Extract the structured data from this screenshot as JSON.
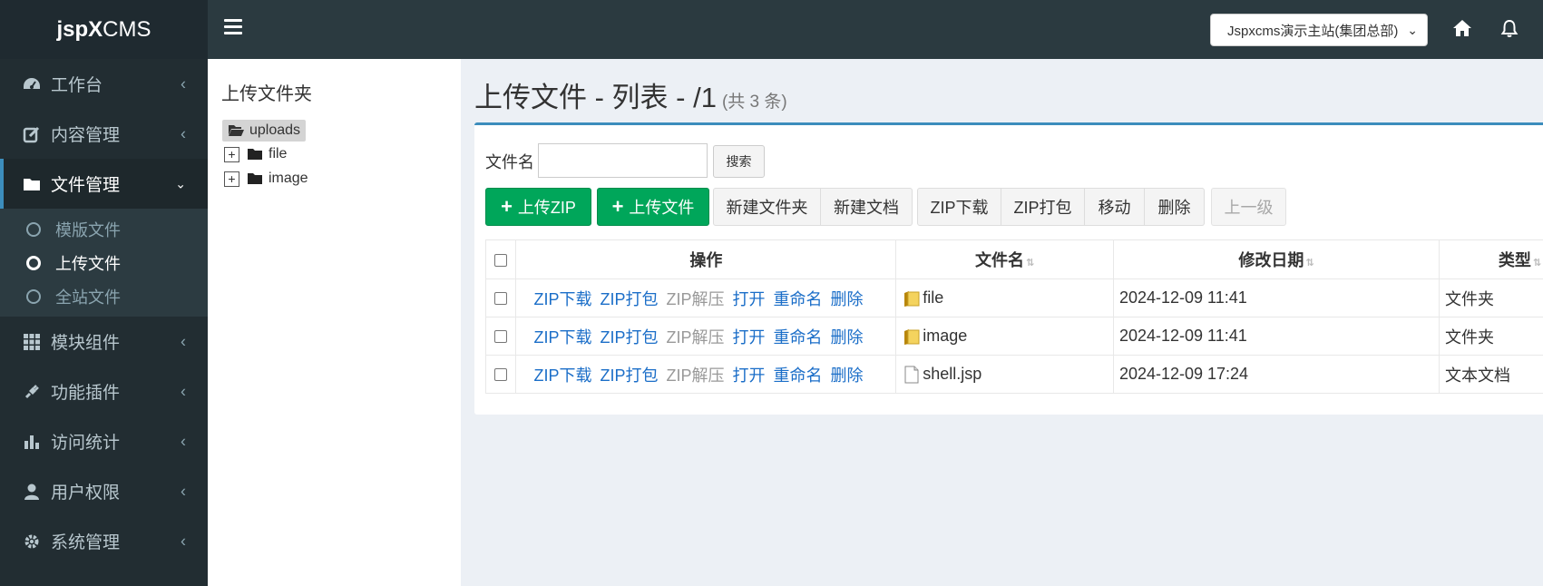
{
  "brand": {
    "bold": "jspX",
    "rest": "CMS"
  },
  "sidebar": {
    "items": [
      {
        "label": "工作台"
      },
      {
        "label": "内容管理"
      },
      {
        "label": "文件管理"
      },
      {
        "label": "模块组件"
      },
      {
        "label": "功能插件"
      },
      {
        "label": "访问统计"
      },
      {
        "label": "用户权限"
      },
      {
        "label": "系统管理"
      }
    ],
    "submenu": [
      {
        "label": "模版文件"
      },
      {
        "label": "上传文件"
      },
      {
        "label": "全站文件"
      }
    ]
  },
  "topbar": {
    "site_select": "Jspxcms演示主站(集团总部)"
  },
  "tree": {
    "title": "上传文件夹",
    "root": "uploads",
    "nodes": [
      {
        "label": "file"
      },
      {
        "label": "image"
      }
    ]
  },
  "page": {
    "title": "上传文件 - 列表 - /1",
    "count": "(共 3 条)"
  },
  "search": {
    "label": "文件名",
    "value": "",
    "button": "搜索"
  },
  "toolbar": {
    "upload_zip": "上传ZIP",
    "upload_file": "上传文件",
    "new_folder": "新建文件夹",
    "new_doc": "新建文档",
    "zip_download": "ZIP下载",
    "zip_pack": "ZIP打包",
    "move": "移动",
    "delete": "删除",
    "up_level": "上一级"
  },
  "table": {
    "headers": {
      "ops": "操作",
      "name": "文件名",
      "date": "修改日期",
      "type": "类型"
    },
    "op_labels": {
      "zip_download": "ZIP下载",
      "zip_pack": "ZIP打包",
      "unzip": "ZIP解压",
      "open": "打开",
      "rename": "重命名",
      "delete": "删除"
    },
    "rows": [
      {
        "name": "file",
        "date": "2024-12-09 11:41",
        "type": "文件夹",
        "icon": "folder-icon"
      },
      {
        "name": "image",
        "date": "2024-12-09 11:41",
        "type": "文件夹",
        "icon": "folder-icon"
      },
      {
        "name": "shell.jsp",
        "date": "2024-12-09 17:24",
        "type": "文本文档",
        "icon": "document-icon"
      }
    ]
  },
  "colors": {
    "sidebar_bg": "#222d32",
    "accent": "#3c8dbc",
    "success": "#00a65a",
    "link": "#1b6ec8"
  }
}
